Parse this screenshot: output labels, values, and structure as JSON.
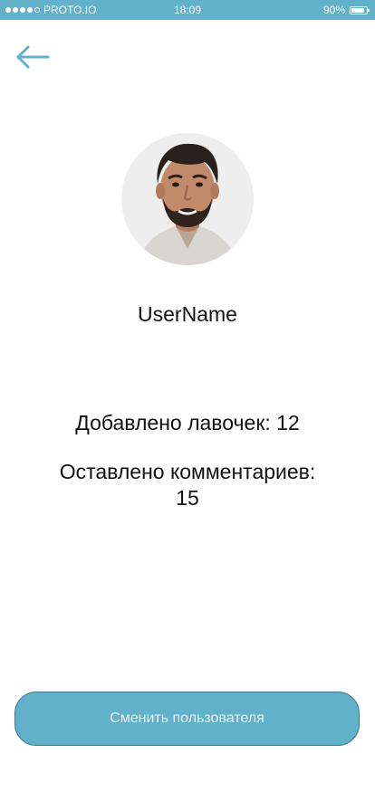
{
  "status_bar": {
    "carrier": "PROTO.IO",
    "time": "18:09",
    "battery": "90%",
    "battery_level": 0.9,
    "background_color": "#62b1cb"
  },
  "back_button": {
    "icon": "arrow-left-icon",
    "color": "#62b1cb"
  },
  "profile": {
    "avatar": "user-photo",
    "username": "UserName"
  },
  "stats": {
    "benches_added_label": "Добавлено лавочек:",
    "benches_added_value": "12",
    "comments_left_label": "Оставлено комментариев:",
    "comments_left_value": "15"
  },
  "actions": {
    "switch_user_label": "Сменить пользователя",
    "button_color": "#62b1cb"
  }
}
